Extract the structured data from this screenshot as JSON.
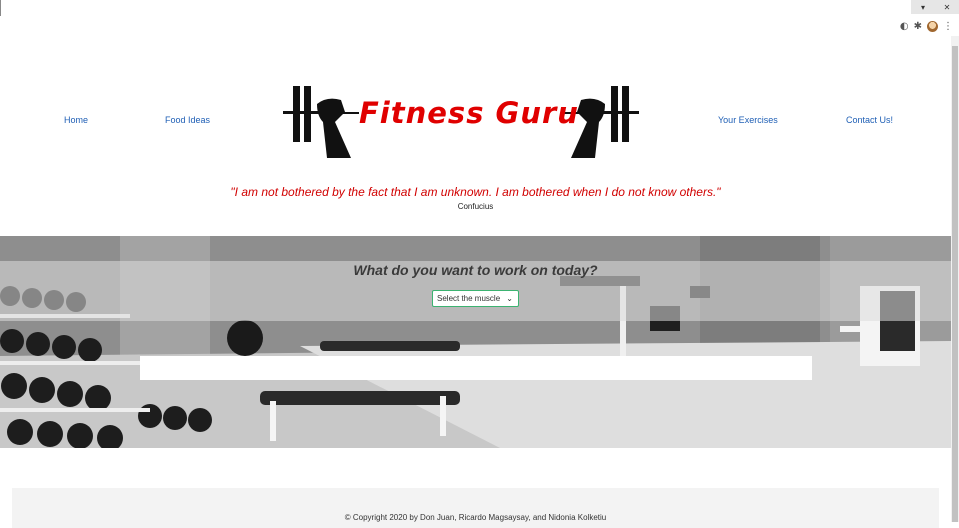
{
  "browser": {
    "window_controls": [
      "▾",
      "✕"
    ],
    "icons": [
      "extension-icon",
      "puzzle-icon",
      "profile-avatar",
      "menu-dots-icon"
    ]
  },
  "nav": {
    "home": "Home",
    "food": "Food Ideas",
    "exercises": "Your Exercises",
    "contact": "Contact Us!"
  },
  "logo": {
    "text": "Fitness Guru"
  },
  "quote": {
    "text": "\"I am not bothered by the fact that I am unknown. I am bothered when I do not know others.\"",
    "author": "Confucius"
  },
  "hero": {
    "title": "What do you want to work on today?",
    "select_value": "Select the muscle",
    "select_chevron": "⌄"
  },
  "footer": {
    "copyright": "© Copyright 2020 by Don Juan, Ricardo Magsaysay, and Nidonia Kolketiu"
  },
  "colors": {
    "brand_red": "#e00000",
    "link_blue": "#1f5fb5",
    "select_border": "#3cb371"
  }
}
